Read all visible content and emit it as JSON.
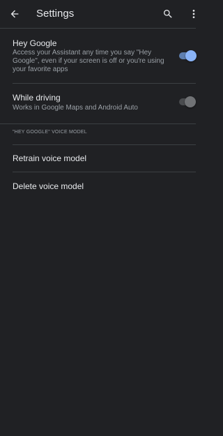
{
  "appbar": {
    "title": "Settings",
    "back_icon": "arrow-back-icon",
    "search_icon": "search-icon",
    "more_icon": "more-vert-icon"
  },
  "hey_google": {
    "title": "Hey Google",
    "subtitle": "Access your Assistant any time you say \"Hey Google\", even if your screen is off or you're using your favorite apps",
    "enabled": true
  },
  "while_driving": {
    "title": "While driving",
    "subtitle": "Works in Google Maps and Android Auto",
    "enabled": false
  },
  "voice_model_section": {
    "header": "\"HEY GOOGLE\" VOICE MODEL"
  },
  "actions": {
    "retrain": "Retrain voice model",
    "delete": "Delete voice model"
  },
  "colors": {
    "background": "#202124",
    "divider": "#3c4043",
    "switch_on_thumb": "#8ab4f8",
    "switch_on_track": "#5e7fb0",
    "switch_off_thumb": "#707275",
    "switch_off_track": "#4a4c4f"
  }
}
